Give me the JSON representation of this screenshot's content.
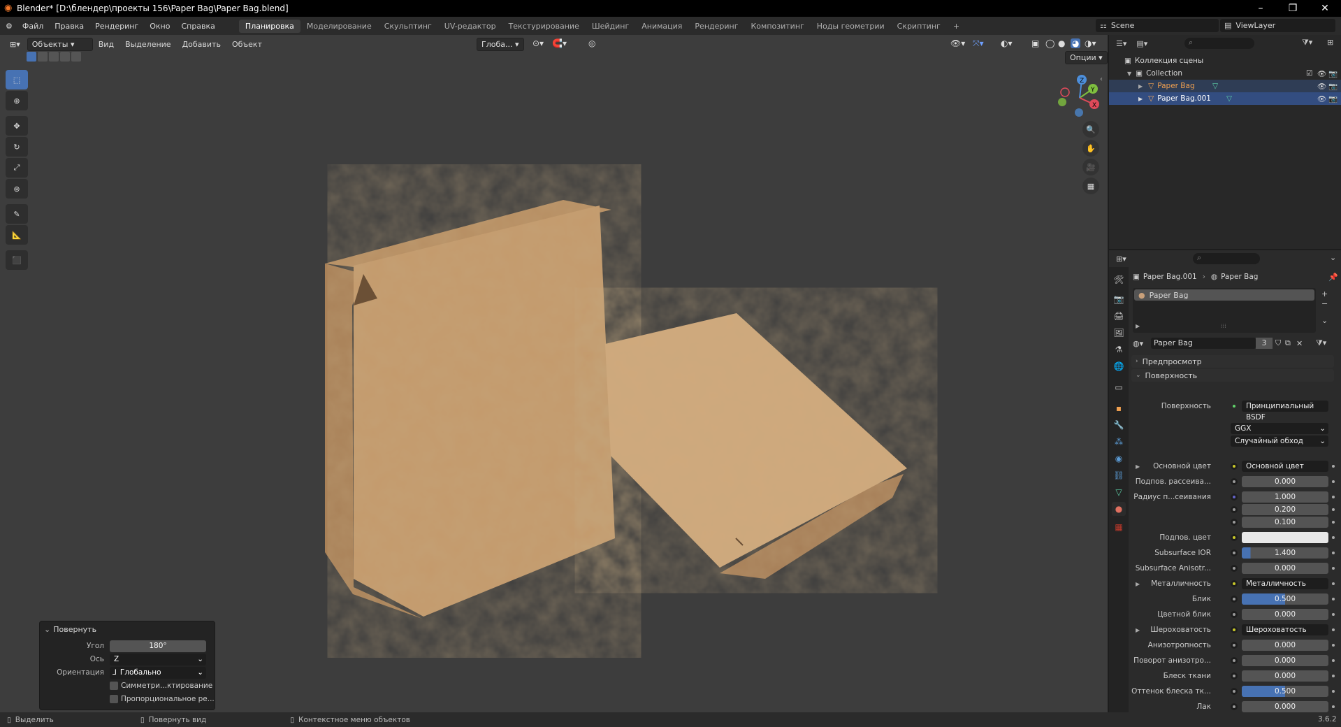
{
  "window": {
    "title": "Blender* [D:\\блендер\\проекты 156\\Paper Bag\\Paper Bag.blend]",
    "minimize": "–",
    "maximize": "❐",
    "close": "✕"
  },
  "menu": {
    "items": [
      "Файл",
      "Правка",
      "Рендеринг",
      "Окно",
      "Справка"
    ]
  },
  "workspaces": {
    "tabs": [
      "Планировка",
      "Моделирование",
      "Скульптинг",
      "UV-редактор",
      "Текстурирование",
      "Шейдинг",
      "Анимация",
      "Рендеринг",
      "Композитинг",
      "Ноды геометрии",
      "Скриптинг"
    ],
    "active": "Планировка",
    "add": "+"
  },
  "scene": {
    "label": "Scene",
    "view_layer": "ViewLayer"
  },
  "viewport": {
    "mode": "Объекты",
    "menus": [
      "Вид",
      "Выделение",
      "Добавить",
      "Объект"
    ],
    "orientation": "Глоба...",
    "options": "Опции",
    "gizmo": {
      "x": "X",
      "y": "Y",
      "z": "Z"
    }
  },
  "operator_panel": {
    "title": "Повернуть",
    "angle_label": "Угол",
    "angle_value": "180°",
    "axis_label": "Ось",
    "axis_value": "Z",
    "orientation_label": "Ориентация",
    "orientation_value": "Глобально",
    "symmetry_label": "Симметри...ктирование",
    "proportional_label": "Пропорциональное ре..."
  },
  "outliner": {
    "root": "Коллекция сцены",
    "collection": "Collection",
    "objects": [
      {
        "name": "Paper Bag",
        "selected": false
      },
      {
        "name": "Paper Bag.001",
        "selected": true
      }
    ]
  },
  "properties": {
    "breadcrumb_object": "Paper Bag.001",
    "breadcrumb_material": "Paper Bag",
    "slot_name": "Paper Bag",
    "material_name": "Paper Bag",
    "users": "3",
    "section_preview": "Предпросмотр",
    "section_surface": "Поверхность",
    "surface_label": "Поверхность",
    "surface_value": "Принципиальный BSDF",
    "distribution": "GGX",
    "subsurface_method": "Случайный обход",
    "rows": [
      {
        "label": "Основной цвет",
        "value": "Основной цвет",
        "kind": "link"
      },
      {
        "label": "Подпов. рассеива...",
        "value": "0.000",
        "kind": "num",
        "fill": 0
      },
      {
        "label": "Радиус п...сеивания",
        "value": "1.000",
        "kind": "num",
        "fill": 0
      },
      {
        "label": "",
        "value": "0.200",
        "kind": "num",
        "fill": 0
      },
      {
        "label": "",
        "value": "0.100",
        "kind": "num",
        "fill": 0
      },
      {
        "label": "Подпов. цвет",
        "value": "",
        "kind": "color"
      },
      {
        "label": "Subsurface IOR",
        "value": "1.400",
        "kind": "num",
        "fill": 0.1
      },
      {
        "label": "Subsurface Anisotr...",
        "value": "0.000",
        "kind": "num",
        "fill": 0
      },
      {
        "label": "Металличность",
        "value": "Металличность",
        "kind": "link"
      },
      {
        "label": "Блик",
        "value": "0.500",
        "kind": "num",
        "fill": 0.5
      },
      {
        "label": "Цветной блик",
        "value": "0.000",
        "kind": "num",
        "fill": 0
      },
      {
        "label": "Шероховатость",
        "value": "Шероховатость",
        "kind": "link"
      },
      {
        "label": "Анизотропность",
        "value": "0.000",
        "kind": "num",
        "fill": 0
      },
      {
        "label": "Поворот анизотро...",
        "value": "0.000",
        "kind": "num",
        "fill": 0
      },
      {
        "label": "Блеск ткани",
        "value": "0.000",
        "kind": "num",
        "fill": 0
      },
      {
        "label": "Оттенок блеска тк...",
        "value": "0.500",
        "kind": "num",
        "fill": 0.5
      },
      {
        "label": "Лак",
        "value": "0.000",
        "kind": "num",
        "fill": 0
      }
    ]
  },
  "status": {
    "select": "Выделить",
    "rotate_view": "Повернуть вид",
    "context_menu": "Контекстное меню объектов",
    "version": "3.6.2"
  },
  "colors": {
    "accent": "#4772b3",
    "viewport_bg": "#3d3d3d",
    "selected_row": "#334d80",
    "object_orange": "#f0a050",
    "paper": "#c49a6c"
  }
}
